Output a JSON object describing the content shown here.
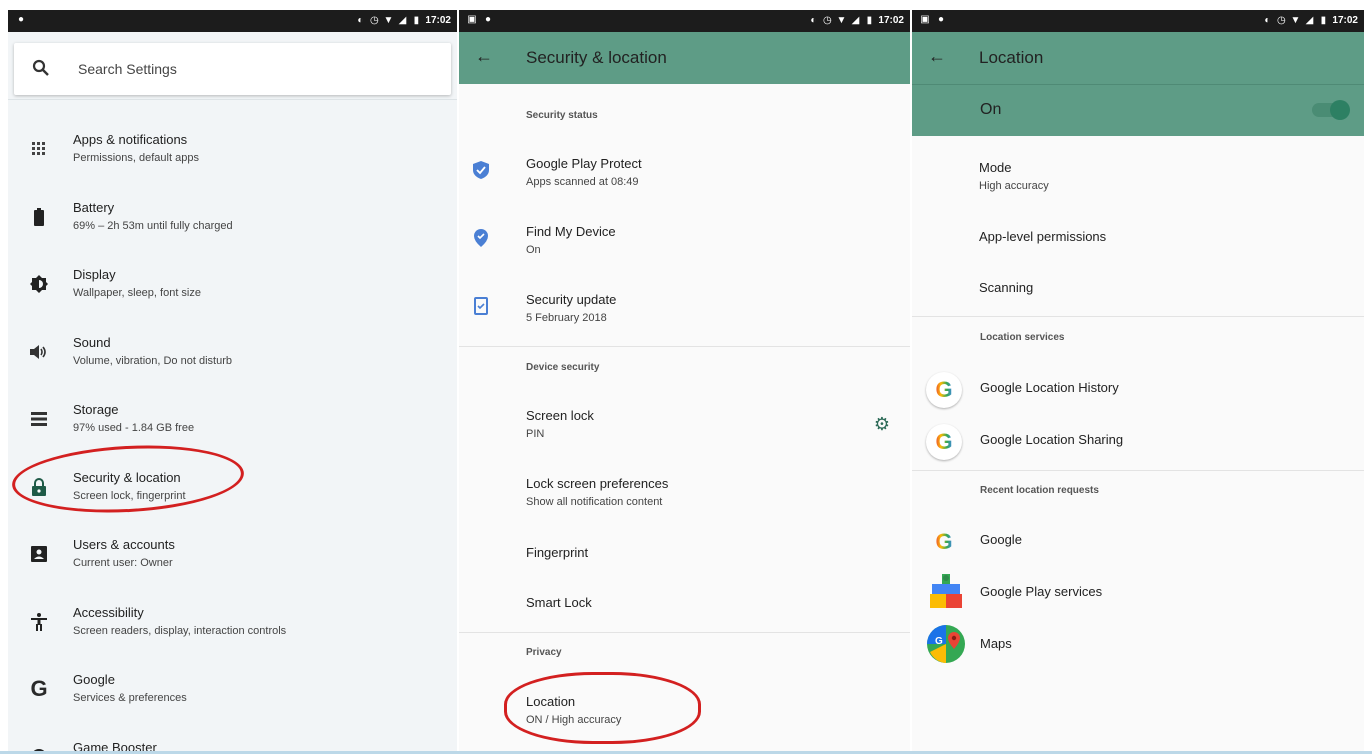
{
  "status_time": "17:02",
  "panel1": {
    "search_placeholder": "Search Settings",
    "items": [
      {
        "title": "Apps & notifications",
        "subtitle": "Permissions, default apps",
        "icon": "apps-grid-icon"
      },
      {
        "title": "Battery",
        "subtitle": "69% – 2h 53m until fully charged",
        "icon": "battery-icon"
      },
      {
        "title": "Display",
        "subtitle": "Wallpaper, sleep, font size",
        "icon": "brightness-icon"
      },
      {
        "title": "Sound",
        "subtitle": "Volume, vibration, Do not disturb",
        "icon": "volume-icon"
      },
      {
        "title": "Storage",
        "subtitle": "97% used - 1.84 GB free",
        "icon": "storage-icon"
      },
      {
        "title": "Security & location",
        "subtitle": "Screen lock, fingerprint",
        "icon": "lock-icon"
      },
      {
        "title": "Users & accounts",
        "subtitle": "Current user: Owner",
        "icon": "account-icon"
      },
      {
        "title": "Accessibility",
        "subtitle": "Screen readers, display, interaction controls",
        "icon": "accessibility-icon"
      },
      {
        "title": "Google",
        "subtitle": "Services & preferences",
        "icon": "google-icon"
      },
      {
        "title": "Game Booster",
        "subtitle": "",
        "icon": "game-booster-icon"
      }
    ]
  },
  "panel2": {
    "title": "Security & location",
    "section_status": "Security status",
    "section_device": "Device security",
    "section_privacy": "Privacy",
    "status_items": [
      {
        "title": "Google Play Protect",
        "subtitle": "Apps scanned at 08:49"
      },
      {
        "title": "Find My Device",
        "subtitle": "On"
      },
      {
        "title": "Security update",
        "subtitle": "5 February 2018"
      }
    ],
    "device_items": [
      {
        "title": "Screen lock",
        "subtitle": "PIN"
      },
      {
        "title": "Lock screen preferences",
        "subtitle": "Show all notification content"
      },
      {
        "title": "Fingerprint",
        "subtitle": ""
      },
      {
        "title": "Smart Lock",
        "subtitle": ""
      }
    ],
    "privacy_items": [
      {
        "title": "Location",
        "subtitle": "ON / High accuracy"
      }
    ]
  },
  "panel3": {
    "title": "Location",
    "toggle_label": "On",
    "toggle_on": true,
    "mode_title": "Mode",
    "mode_value": "High accuracy",
    "app_permissions": "App-level permissions",
    "scanning": "Scanning",
    "section_services": "Location services",
    "services": [
      "Google Location History",
      "Google Location Sharing"
    ],
    "section_recent": "Recent location requests",
    "recent": [
      "Google",
      "Google Play services",
      "Maps"
    ]
  },
  "colors": {
    "accent": "#5e9c86",
    "highlight_circle": "#d32020",
    "shield_blue": "#4a7fd4"
  }
}
